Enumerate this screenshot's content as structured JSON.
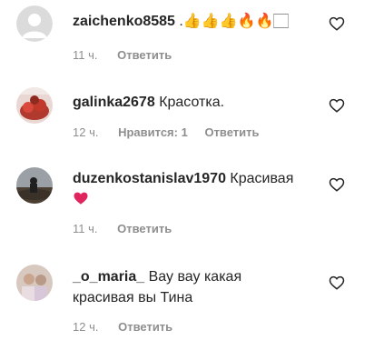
{
  "comments": [
    {
      "username": "zaichenko8585",
      "text": ".👍👍👍🔥🔥🏻",
      "time": "11 ч.",
      "reply": "Ответить"
    },
    {
      "username": "galinka2678",
      "text": "Красотка.",
      "time": "12 ч.",
      "likes": "Нравится: 1",
      "reply": "Ответить"
    },
    {
      "username": "duzenkostanislav1970",
      "text": "Красивая",
      "text2": "❤",
      "time": "11 ч.",
      "reply": "Ответить"
    },
    {
      "username": "_o_maria_",
      "text": "Вау вау какая",
      "text2": "красивая вы Тина",
      "time": "12 ч.",
      "reply": "Ответить"
    }
  ],
  "icons": {
    "like": "heart-outline-icon",
    "avatar_placeholder": "user-placeholder-icon"
  },
  "colors": {
    "text": "#262626",
    "muted": "#8e8e8e",
    "heart_red": "#ed4956"
  }
}
